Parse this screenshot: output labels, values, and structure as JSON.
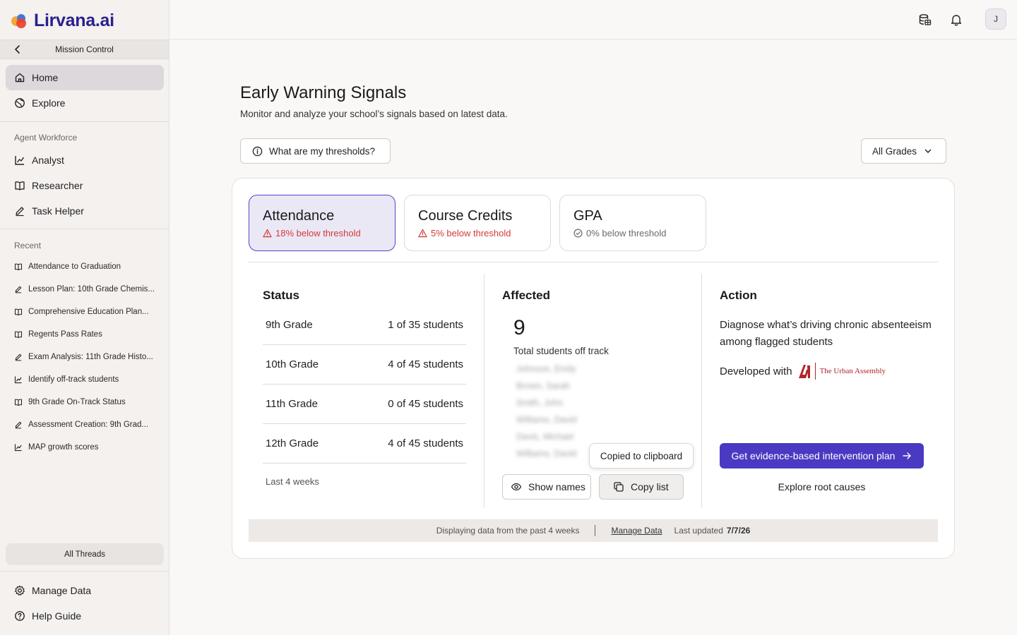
{
  "app": {
    "logo_text": "Lirvana.ai"
  },
  "sidebar": {
    "back_title": "Mission Control",
    "primary": [
      {
        "label": "Home",
        "icon": "home-icon",
        "active": true
      },
      {
        "label": "Explore",
        "icon": "globe-icon",
        "active": false
      }
    ],
    "agent_section": "Agent Workforce",
    "agents": [
      {
        "label": "Analyst",
        "icon": "chart-line-icon"
      },
      {
        "label": "Researcher",
        "icon": "book-icon"
      },
      {
        "label": "Task Helper",
        "icon": "pencil-icon"
      }
    ],
    "recent_section": "Recent",
    "recent": [
      {
        "label": "Attendance to Graduation",
        "icon": "book-icon"
      },
      {
        "label": "Lesson Plan: 10th Grade Chemis...",
        "icon": "pencil-icon"
      },
      {
        "label": "Comprehensive Education Plan...",
        "icon": "book-icon"
      },
      {
        "label": "Regents Pass Rates",
        "icon": "book-icon"
      },
      {
        "label": "Exam Analysis: 11th Grade Histo...",
        "icon": "pencil-icon"
      },
      {
        "label": "Identify off-track students",
        "icon": "chart-line-icon"
      },
      {
        "label": "9th Grade On-Track Status",
        "icon": "book-icon"
      },
      {
        "label": "Assessment Creation: 9th Grad...",
        "icon": "pencil-icon"
      },
      {
        "label": "MAP growth scores",
        "icon": "chart-line-icon"
      }
    ],
    "all_threads": "All Threads",
    "bottom": [
      {
        "label": "Manage Data",
        "icon": "gear-icon"
      },
      {
        "label": "Help Guide",
        "icon": "help-circle-icon"
      }
    ]
  },
  "topbar": {
    "avatar_initial": "J"
  },
  "main": {
    "title": "Early Warning Signals",
    "subtitle": "Monitor and analyze your school’s signals based on latest data.",
    "threshold_button": "What are my thresholds?",
    "grade_filter": "All Grades"
  },
  "tabs": [
    {
      "title": "Attendance",
      "status": "18% below threshold",
      "kind": "warn",
      "active": true
    },
    {
      "title": "Course Credits",
      "status": "5% below threshold",
      "kind": "warn",
      "active": false
    },
    {
      "title": "GPA",
      "status": "0% below threshold",
      "kind": "ok",
      "active": false
    }
  ],
  "status": {
    "heading": "Status",
    "rows": [
      {
        "grade": "9th Grade",
        "value": "1 of 35 students"
      },
      {
        "grade": "10th Grade",
        "value": "4 of 45 students"
      },
      {
        "grade": "11th Grade",
        "value": "0 of 45 students"
      },
      {
        "grade": "12th Grade",
        "value": "4 of 45 students"
      }
    ],
    "footer": "Last 4 weeks"
  },
  "affected": {
    "heading": "Affected",
    "count": "9",
    "count_label": "Total students off track",
    "names": [
      "Johnson, Emily",
      "Brown, Sarah",
      "Smith, John",
      "Williams, David",
      "Davis, Michael",
      "Williams, David"
    ],
    "tooltip": "Copied to clipboard",
    "show_names": "Show names",
    "copy_list": "Copy list"
  },
  "action": {
    "heading": "Action",
    "text": "Diagnose what’s driving chronic absenteeism among flagged students",
    "developed_with": "Developed with",
    "partner_name": "The Urban Assembly",
    "cta": "Get evidence-based intervention plan",
    "secondary": "Explore root causes"
  },
  "footer": {
    "range_text": "Displaying data from the past 4 weeks",
    "manage": "Manage Data",
    "last_updated_label": "Last updated",
    "last_updated_value": "7/7/26"
  },
  "colors": {
    "brand": "#4a39c2",
    "warn": "#d23a35",
    "active_tab_bg": "#ebe8f6"
  }
}
